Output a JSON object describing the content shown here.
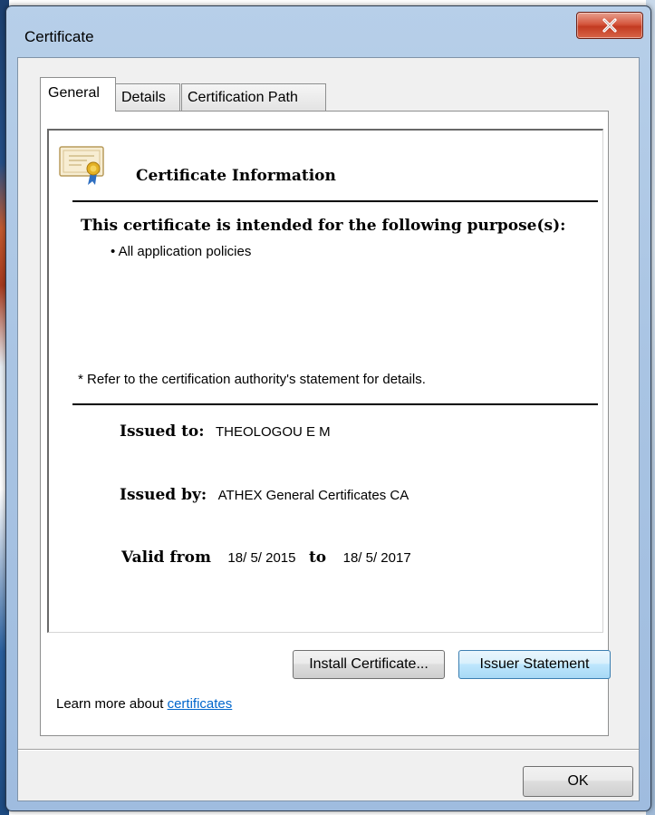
{
  "window": {
    "title": "Certificate",
    "close_glyph": "X"
  },
  "tabs": [
    {
      "label": "General",
      "active": true
    },
    {
      "label": "Details",
      "active": false
    },
    {
      "label": "Certification Path",
      "active": false
    }
  ],
  "info": {
    "icon": "certificate-icon",
    "heading": "Certificate Information",
    "purpose_heading": "This certificate is intended for the following purpose(s):",
    "policies": [
      "• All application policies"
    ],
    "refer_note": "* Refer to the certification authority's statement for details.",
    "issued_to_label": "Issued to:",
    "issued_to_value": "THEOLOGOU E M",
    "issued_by_label": "Issued by:",
    "issued_by_value": "ATHEX General Certificates CA",
    "valid_from_label": "Valid from",
    "valid_from_value": "18/ 5/ 2015",
    "valid_to_label": "to",
    "valid_to_value": "18/ 5/ 2017"
  },
  "buttons": {
    "install": "Install Certificate...",
    "issuer": "Issuer Statement",
    "ok": "OK"
  },
  "learn_more": {
    "prefix": "Learn more about ",
    "link": "certificates"
  },
  "colors": {
    "link": "#0066cc",
    "close_button": "#c23b22",
    "title_bar": "#a9c4e3"
  }
}
